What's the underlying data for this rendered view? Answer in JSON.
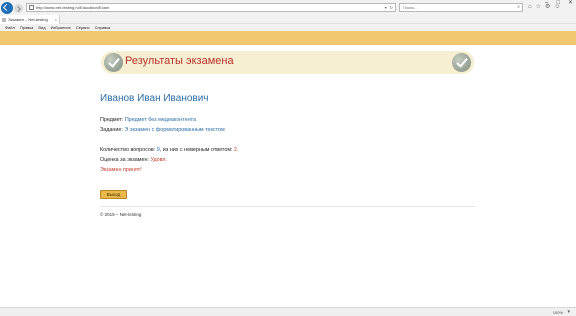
{
  "browser": {
    "url": "http://www.net-testing.ru/Education/Exam",
    "search_placeholder": "Поиск...",
    "tab_title": "Экзамен – Net-testing",
    "menu": [
      "Файл",
      "Правка",
      "Вид",
      "Избранное",
      "Сервис",
      "Справка"
    ],
    "zoom": "100%"
  },
  "page": {
    "banner_title": "Результаты экзамена",
    "student_name": "Иванов Иван Иванович",
    "subject_label": "Предмет:",
    "subject_value": "Предмет без медиаконтента",
    "task_label": "Задание:",
    "task_value": "Э экзамен с форматированным текстом",
    "questions_label": "Количество вопросов:",
    "questions_count": "9",
    "wrong_label": ", из них с неверным ответом:",
    "wrong_count": "2",
    "grade_label": "Оценка за экзамен:",
    "grade_value": "Удовл.",
    "status": "Экзамен принят!",
    "exit_button": "Выход",
    "copyright": "© 2019 – Net-testing"
  },
  "colors": {
    "top_band": "#f0c870",
    "banner_bg": "#f6efd1",
    "title_red": "#b8322b",
    "link_blue": "#2b6ea8",
    "button_gold": "#e8b84a"
  }
}
